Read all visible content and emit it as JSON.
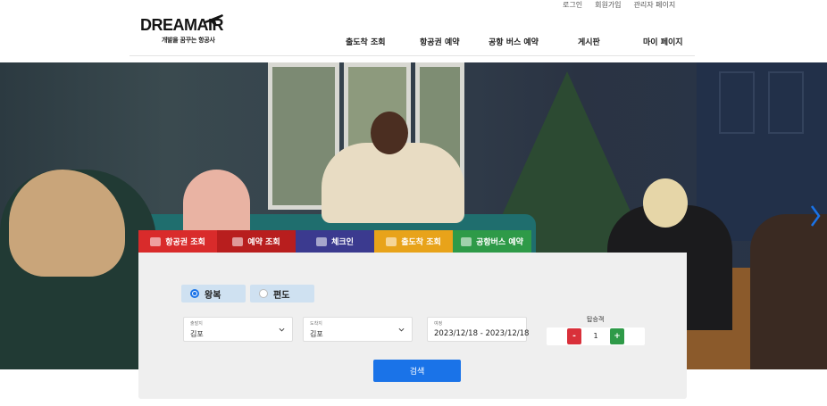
{
  "colors": {
    "primary": "#1a73e8",
    "tab_flight_search": "#d92b2b",
    "tab_booking_search": "#b81e1e",
    "tab_checkin": "#3b3a8f",
    "tab_arrival_departure": "#e8a31a",
    "tab_bus_booking": "#2e9a48",
    "minus_button": "#d9303a",
    "plus_button": "#2e9a48",
    "trip_type_bg": "#cfe1f1",
    "panel_bg": "#efefef"
  },
  "util_links": [
    "로그인",
    "회원가입",
    "관리자 페이지"
  ],
  "logo": {
    "main": "DREAMAIR",
    "tagline": "개발을 꿈꾸는 항공사"
  },
  "nav": [
    "출도착 조회",
    "항공권 예약",
    "공항 버스 예약",
    "게시판",
    "마이 페이지"
  ],
  "hero": {
    "next_icon": "chevron-right-icon"
  },
  "tabs": [
    {
      "label": "항공권 조회",
      "icon": "plane-icon"
    },
    {
      "label": "예약 조회",
      "icon": "ticket-icon"
    },
    {
      "label": "체크인",
      "icon": "passport-icon"
    },
    {
      "label": "출도착 조회",
      "icon": "board-icon"
    },
    {
      "label": "공항버스 예약",
      "icon": "bus-icon"
    }
  ],
  "trip_types": [
    {
      "label": "왕복",
      "selected": true
    },
    {
      "label": "편도",
      "selected": false
    }
  ],
  "departure": {
    "label": "출발지",
    "value": "김포"
  },
  "arrival": {
    "label": "도착지",
    "value": "김포"
  },
  "schedule": {
    "label": "여정",
    "value": "2023/12/18 - 2023/12/18"
  },
  "passengers": {
    "label": "탑승객",
    "minus": "-",
    "count": "1",
    "plus": "+"
  },
  "search_button": "검색"
}
